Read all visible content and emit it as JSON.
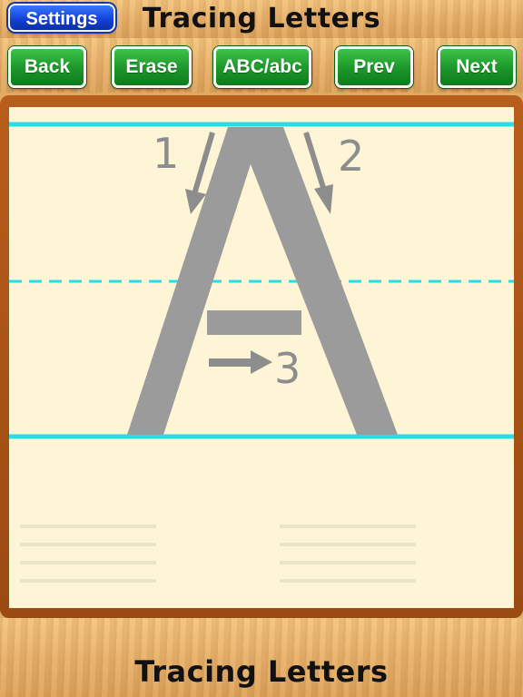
{
  "header": {
    "settings_label": "Settings",
    "title": "Tracing Letters"
  },
  "toolbar": {
    "back_label": "Back",
    "erase_label": "Erase",
    "case_label": "ABC/abc",
    "prev_label": "Prev",
    "next_label": "Next"
  },
  "board": {
    "letter": "A",
    "stroke_numbers": [
      "1",
      "2",
      "3"
    ],
    "guide_color": "#22dfe8",
    "letter_color": "#9b9b9b"
  },
  "footer": {
    "title": "Tracing Letters"
  },
  "colors": {
    "settings_blue": "#1443d8",
    "button_green": "#1d9a2b",
    "frame_brown": "#a8531a",
    "paper": "#fdf5d6"
  }
}
